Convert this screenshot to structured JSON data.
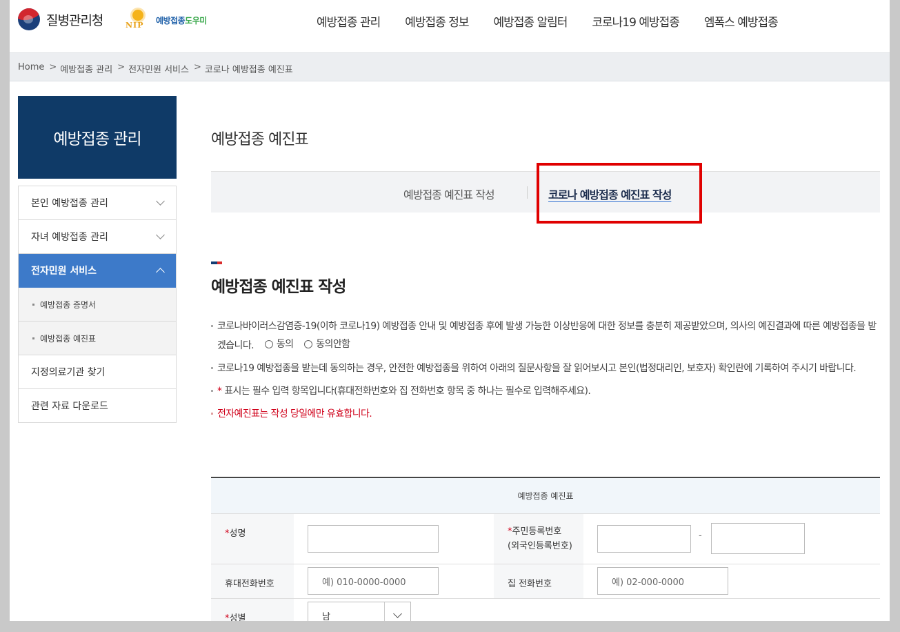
{
  "header": {
    "agency_name": "질병관리청",
    "helper_logo": {
      "prefix": "예방접종",
      "highlight": "도우미",
      "mark_text": "NIP"
    },
    "nav": [
      "예방접종 관리",
      "예방접종 정보",
      "예방접종 알림터",
      "코로나19 예방접종",
      "엠폭스 예방접종"
    ]
  },
  "breadcrumb": [
    "Home",
    "예방접종 관리",
    "전자민원 서비스",
    "코로나 예방접종 예진표"
  ],
  "sidebar": {
    "title": "예방접종 관리",
    "items": [
      {
        "label": "본인 예방접종 관리"
      },
      {
        "label": "자녀 예방접종 관리"
      },
      {
        "label": "전자민원 서비스"
      },
      {
        "label": "예방접종 증명서"
      },
      {
        "label": "예방접종 예진표"
      },
      {
        "label": "지정의료기관 찾기"
      },
      {
        "label": "관련 자료 다운로드"
      }
    ]
  },
  "main": {
    "page_title": "예방접종 예진표",
    "tabs": [
      {
        "label": "예방접종 예진표 작성"
      },
      {
        "label": "코로나 예방접종 예진표 작성"
      }
    ],
    "section_title": "예방접종 예진표 작성",
    "notes": {
      "consent_text": "코로나바이러스감염증-19(이하 코로나19) 예방접종 안내 및 예방접종 후에 발생 가능한 이상반응에 대한 정보를 충분히 제공받았으며, 의사의 예진결과에 따른 예방접종을 받겠습니다.",
      "agree_label": "동의",
      "disagree_label": "동의안함",
      "note2": "코로나19 예방접종을 받는데 동의하는 경우, 안전한 예방접종을 위하여 아래의 질문사항을 잘 읽어보시고 본인(법정대리인, 보호자) 확인란에 기록하여 주시기 바랍니다.",
      "note3_star": "*",
      "note3": " 표시는 필수 입력 항목입니다(휴대전화번호와 집 전화번호 항목 중 하나는 필수로 입력해주세요).",
      "note4": "전자예진표는 작성 당일에만 유효합니다."
    },
    "form": {
      "caption": "예방접종 예진표",
      "required_mark": "*",
      "name_label": "성명",
      "rrn_label_1": "주민등록번호",
      "rrn_label_2": "(외국인등록번호)",
      "rrn_separator": "-",
      "mobile_label": "휴대전화번호",
      "mobile_placeholder": "예) 010-0000-0000",
      "home_phone_label": "집 전화번호",
      "home_phone_placeholder": "예) 02-000-0000",
      "gender_label": "성별",
      "gender_value": "남"
    }
  },
  "colors": {
    "sidebar_title_bg": "#0f3a67",
    "sidebar_active_bg": "#3d7ac9",
    "highlight_border": "#e00000",
    "required_red": "#d0021b"
  }
}
